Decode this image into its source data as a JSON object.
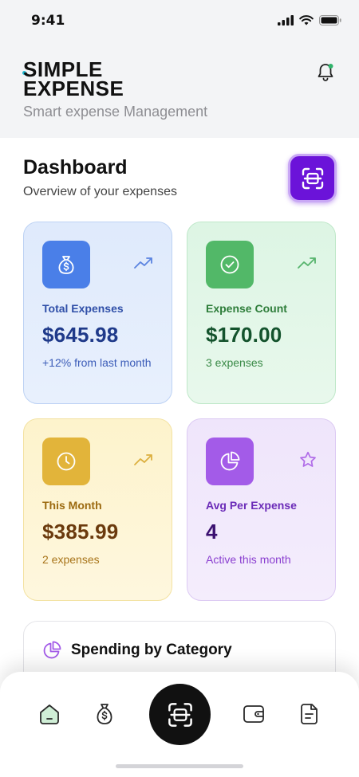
{
  "status_bar": {
    "time": "9:41"
  },
  "header": {
    "logo_line1": "SIMPLE",
    "logo_line2": "EXPENSE",
    "tagline": "Smart expense Management"
  },
  "dashboard": {
    "title": "Dashboard",
    "subtitle": "Overview of your expenses"
  },
  "cards": [
    {
      "label": "Total Expenses",
      "value": "$645.98",
      "note": "+12% from last month",
      "icon": "money-bag-icon",
      "trend_icon": "trending-up-icon"
    },
    {
      "label": "Expense Count",
      "value": "$170.00",
      "note": "3 expenses",
      "icon": "check-circle-icon",
      "trend_icon": "trending-up-icon"
    },
    {
      "label": "This Month",
      "value": "$385.99",
      "note": "2 expenses",
      "icon": "clock-icon",
      "trend_icon": "trending-up-icon"
    },
    {
      "label": "Avg Per Expense",
      "value": "4",
      "note": "Active this month",
      "icon": "pie-chart-icon",
      "trend_icon": "star-icon"
    }
  ],
  "section": {
    "title": "Spending by Category"
  },
  "nav": {
    "items": [
      "home-icon",
      "money-bag-icon",
      "scan-icon",
      "wallet-icon",
      "document-icon"
    ],
    "active": "home"
  },
  "colors": {
    "accent_purple": "#6b13d9",
    "blue": "#4a7fe8",
    "green": "#52b868",
    "yellow": "#e2b43a",
    "purple": "#a35be8",
    "blue_text": "#2f4fa8",
    "green_text": "#2e7d3a",
    "yellow_text": "#9c6a10",
    "purple_text": "#6b2bb8"
  }
}
